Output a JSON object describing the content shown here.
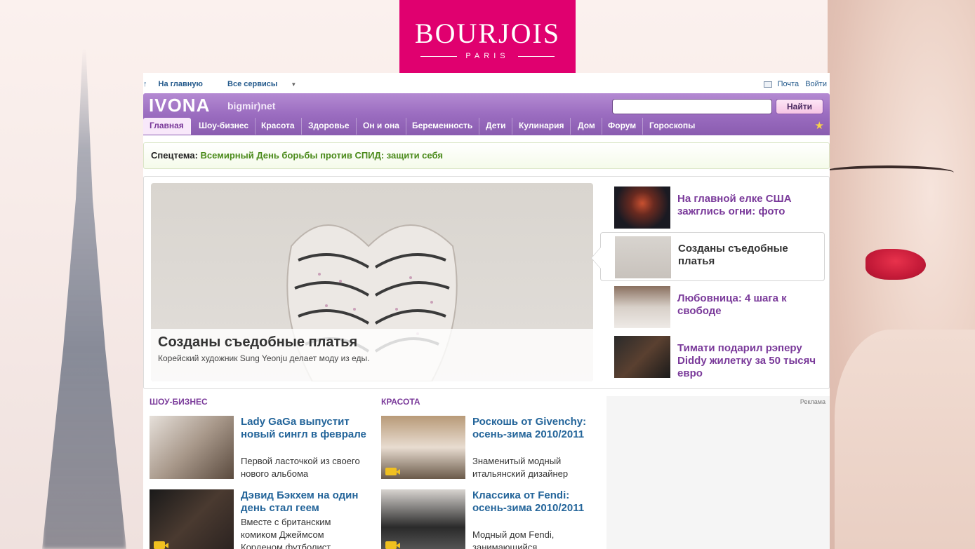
{
  "brand": {
    "name": "BOURJOIS",
    "sub": "PARIS",
    "color": "#e0006f"
  },
  "util": {
    "home": "На главную",
    "services": "Все сервисы",
    "mail": "Почта",
    "login": "Войти"
  },
  "header": {
    "logo": "IVONA",
    "logo_sub": "bigmir)net",
    "search_button": "Найти",
    "search_value": ""
  },
  "nav": [
    {
      "label": "Главная",
      "active": true
    },
    {
      "label": "Шоу-бизнес"
    },
    {
      "label": "Красота"
    },
    {
      "label": "Здоровье"
    },
    {
      "label": "Он и она"
    },
    {
      "label": "Беременность"
    },
    {
      "label": "Дети"
    },
    {
      "label": "Кулинария"
    },
    {
      "label": "Дом"
    },
    {
      "label": "Форум"
    },
    {
      "label": "Гороскопы"
    }
  ],
  "special": {
    "label": "Спецтема:",
    "link": "Всемирный День борьбы против СПИД: защити себя"
  },
  "feature": {
    "title": "Созданы съедобные платья",
    "desc": "Корейский художник Sung Yeonju делает моду из еды."
  },
  "side": [
    {
      "title": "На главной елке США зажглись огни: фото"
    },
    {
      "title": "Созданы съедобные платья",
      "selected": true
    },
    {
      "title": "Любовница: 4 шага к свободе"
    },
    {
      "title": "Тимати подарил рэперу Diddy жилетку за 50 тысяч евро"
    }
  ],
  "sections": {
    "show": {
      "heading": "ШОУ-БИЗНЕС",
      "items": [
        {
          "title": "Lady GaGa выпустит новый сингл в феврале",
          "desc": "Первой ласточкой из своего нового альбома"
        },
        {
          "title": "Дэвид Бэкхем на один день стал геем",
          "desc": "Вместе с британским комиком Джеймсом Корденом футболист"
        }
      ]
    },
    "beauty": {
      "heading": "КРАСОТА",
      "items": [
        {
          "title": "Роскошь от Givenchy: осень-зима 2010/2011",
          "desc": "Знаменитый модный итальянский дизайнер"
        },
        {
          "title": "Классика от Fendi: осень-зима 2010/2011",
          "desc": "Модный дом Fendi, занимающийся"
        }
      ]
    }
  },
  "ad": {
    "label": "Реклама"
  }
}
